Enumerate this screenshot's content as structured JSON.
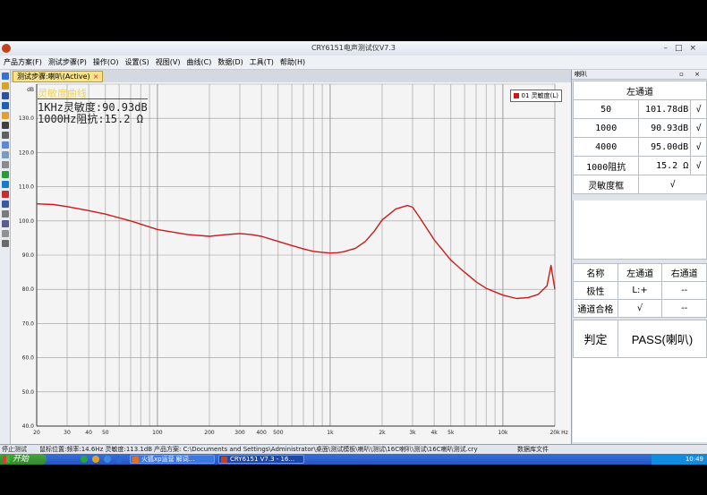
{
  "window": {
    "title": "CRY6151电声测试仪V7.3"
  },
  "menu": [
    "产品方案(F)",
    "测试步骤(P)",
    "操作(O)",
    "设置(S)",
    "视图(V)",
    "曲线(C)",
    "数据(D)",
    "工具(T)",
    "帮助(H)"
  ],
  "doc_tab": {
    "label": "测试步骤:喇叭(Active)",
    "close": "×"
  },
  "plot": {
    "annotation_title": "灵敏度曲线",
    "annotation_sensitivity": "1KHz灵敏度:90.93dB",
    "annotation_impedance": "1000Hz阻抗:15.2 Ω",
    "legend_label": "01 灵敏度(L)",
    "y_unit": "dB",
    "x_unit": "Hz",
    "colors": {
      "curve": "#cc1a1a",
      "background": "#f4f4f4",
      "grid": "#9a9a9a"
    }
  },
  "chart_data": {
    "type": "line",
    "title": "",
    "xlabel": "Hz",
    "ylabel": "",
    "x_scale": "log",
    "xlim": [
      20,
      20000
    ],
    "ylim": [
      40,
      140
    ],
    "grid": true,
    "legend_position": "top-right",
    "x_tick_labels": [
      "20",
      "30",
      "40",
      "50",
      "100",
      "200",
      "300",
      "400",
      "500",
      "1k",
      "2k",
      "3k",
      "4k",
      "5k",
      "10k",
      "20k"
    ],
    "y_tick_labels": [
      "40.0",
      "50.0",
      "60.0",
      "70.0",
      "80.0",
      "90.0",
      "100.0",
      "110.0",
      "120.0",
      "130.0"
    ],
    "x_tick_values": [
      20,
      30,
      40,
      50,
      100,
      200,
      300,
      400,
      500,
      1000,
      2000,
      3000,
      4000,
      5000,
      10000,
      20000
    ],
    "y_tick_values": [
      40,
      50,
      60,
      70,
      80,
      90,
      100,
      110,
      120,
      130
    ],
    "series": [
      {
        "name": "01 灵敏度(L)",
        "x": [
          20,
          25,
          30,
          40,
          50,
          70,
          100,
          150,
          200,
          250,
          300,
          350,
          400,
          500,
          600,
          700,
          800,
          900,
          1000,
          1100,
          1200,
          1400,
          1600,
          1800,
          2000,
          2400,
          2800,
          3000,
          3300,
          4000,
          5000,
          6000,
          7000,
          8000,
          10000,
          12000,
          14000,
          16000,
          18000,
          19000,
          20000
        ],
        "y": [
          105,
          104.8,
          104.2,
          103,
          102,
          100,
          97.5,
          96,
          95.5,
          96,
          96.3,
          96,
          95.5,
          94,
          92.8,
          91.8,
          91.1,
          90.8,
          90.6,
          90.7,
          91,
          92,
          94,
          97,
          100.3,
          103.5,
          104.5,
          104,
          101,
          94.5,
          88.5,
          85,
          82.2,
          80.3,
          78.3,
          77.3,
          77.6,
          78.5,
          81,
          87,
          80
        ]
      }
    ]
  },
  "right_panel": {
    "title": "喇叭",
    "header_controls": "▫ ×",
    "channel_header": "左通道",
    "rows": [
      {
        "label": "50",
        "value": "101.78dB",
        "check": "√"
      },
      {
        "label": "1000",
        "value": "90.93dB",
        "check": "√"
      },
      {
        "label": "4000",
        "value": "95.00dB",
        "check": "√"
      },
      {
        "label": "1000阻抗",
        "value": "15.2 Ω",
        "check": "√"
      },
      {
        "label": "灵敏度框",
        "value": "",
        "check": "√"
      }
    ],
    "summary": {
      "headers": [
        "名称",
        "左通道",
        "右通道"
      ],
      "rows": [
        [
          "极性",
          "L:+",
          "--"
        ],
        [
          "通道合格",
          "√",
          "--"
        ]
      ]
    },
    "verdict_label": "判定",
    "verdict_value": "PASS(喇叭)"
  },
  "status_bar": {
    "state": "停止测试",
    "mouse": "鼠标位置:频率:14.6Hz 灵敏度:113.1dB",
    "scheme": "产品方案: C:\\Documents and Settings\\Administrator\\桌面\\测试模板\\喇叭\\测试\\16C喇叭\\测试\\16C喇叭测试.cry",
    "db": "数据库文件"
  },
  "taskbar": {
    "start": "开始",
    "tasks": [
      "火狐xp运营 解词...",
      "CRY6151 V7.3 - 16..."
    ],
    "clock": "10:49"
  }
}
